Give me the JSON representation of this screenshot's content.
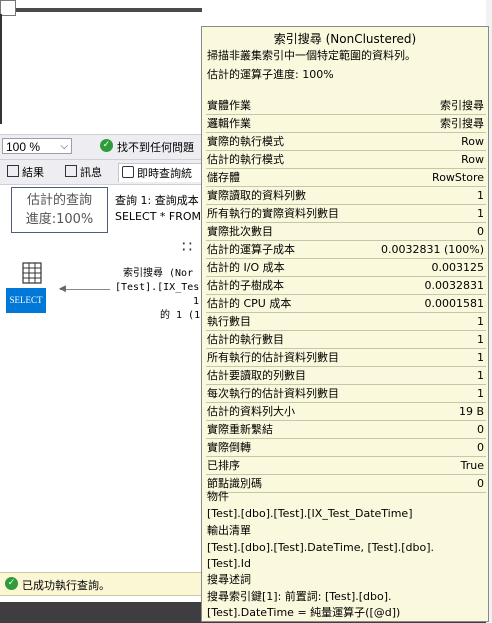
{
  "toolbar": {
    "zoom": "100 %",
    "status_message": "找不到任何問題"
  },
  "tabs": [
    {
      "label": "結果"
    },
    {
      "label": "訊息"
    },
    {
      "label": "即時查詢統"
    }
  ],
  "plan": {
    "progress_line1": "估計的查詢",
    "progress_line2": "進度:100%",
    "query_line1": "查詢 1: 查詢成本",
    "query_line2": "SELECT * FROM T",
    "select_label": "SELECT",
    "op_line1": "索引搜尋 (Nor",
    "op_line2": "[Test].[IX_Tes",
    "op_line3": "1",
    "op_line4": "的 1 (1"
  },
  "status_bar": {
    "text": "已成功執行查詢。"
  },
  "tooltip": {
    "title": "索引搜尋 (NonClustered)",
    "description": "掃描非叢集索引中一個特定範圍的資料列。",
    "progress": "估計的運算子進度: 100%",
    "properties": [
      {
        "key": "實體作業",
        "value": "索引搜尋"
      },
      {
        "key": "邏輯作業",
        "value": "索引搜尋"
      },
      {
        "key": "實際的執行模式",
        "value": "Row"
      },
      {
        "key": "估計的執行模式",
        "value": "Row"
      },
      {
        "key": "儲存體",
        "value": "RowStore"
      },
      {
        "key": "實際讀取的資料列數",
        "value": "1"
      },
      {
        "key": "所有執行的實際資料列數目",
        "value": "1"
      },
      {
        "key": "實際批次數目",
        "value": "0"
      },
      {
        "key": "估計的運算子成本",
        "value": "0.0032831 (100%)"
      },
      {
        "key": "估計的 I/O 成本",
        "value": "0.003125"
      },
      {
        "key": "估計的子樹成本",
        "value": "0.0032831"
      },
      {
        "key": "估計的 CPU 成本",
        "value": "0.0001581"
      },
      {
        "key": "執行數目",
        "value": "1"
      },
      {
        "key": "估計的執行數目",
        "value": "1"
      },
      {
        "key": "所有執行的估計資料列數目",
        "value": "1"
      },
      {
        "key": "估計要讀取的列數目",
        "value": "1"
      },
      {
        "key": "每次執行的估計資料列數目",
        "value": "1"
      },
      {
        "key": "估計的資料列大小",
        "value": "19 B"
      },
      {
        "key": "實際重新繫結",
        "value": "0"
      },
      {
        "key": "實際倒轉",
        "value": "0"
      },
      {
        "key": "已排序",
        "value": "True"
      },
      {
        "key": "節點識別碼",
        "value": "0"
      }
    ],
    "object_heading": "物件",
    "object_value": "[Test].[dbo].[Test].[IX_Test_DateTime]",
    "output_heading": "輸出清單",
    "output_line1": "[Test].[dbo].[Test].DateTime, [Test].[dbo].",
    "output_line2": "[Test].Id",
    "predicate_heading": "搜尋述詞",
    "predicate_line1": "搜尋索引鍵[1]: 前置詞: [Test].[dbo].",
    "predicate_line2": "[Test].DateTime = 純量運算子([@d])"
  }
}
